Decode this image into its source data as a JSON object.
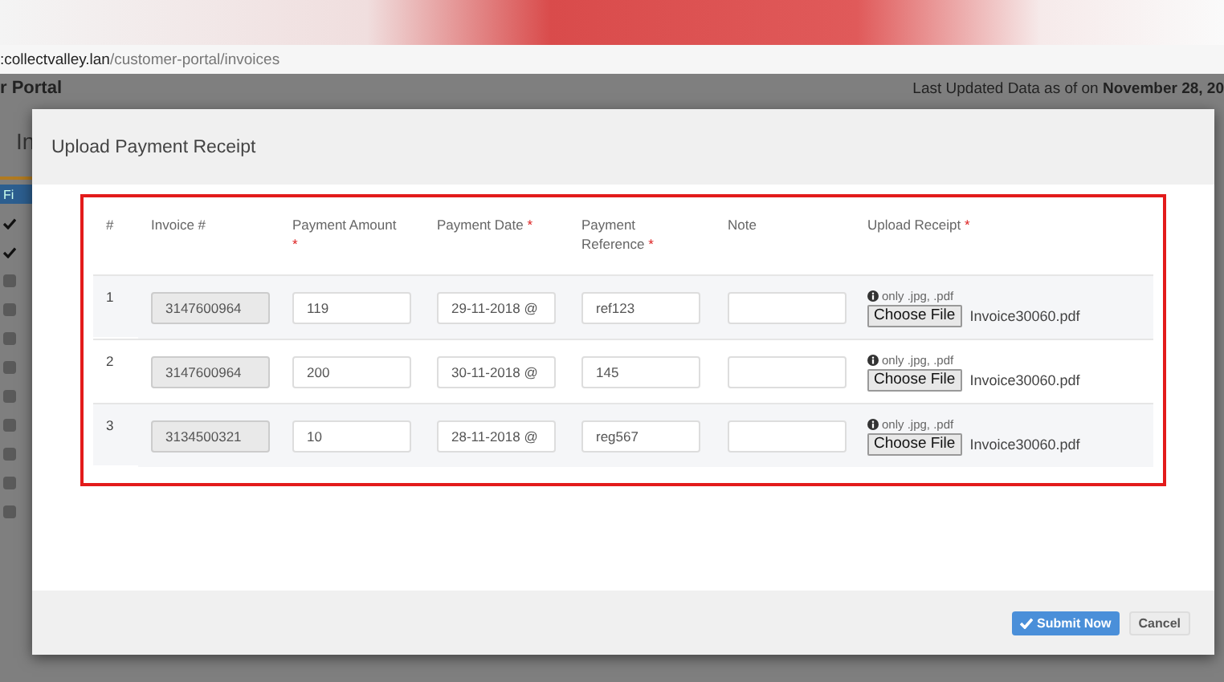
{
  "address_bar": {
    "host": ":collectvalley.lan",
    "path": "/customer-portal/invoices"
  },
  "page": {
    "title": "r Portal",
    "last_updated": "Last Updated Data as of on **November 28, 20**",
    "tab": "In",
    "filter_button": "Fi",
    "row_checks": [
      {
        "checked": true
      },
      {
        "checked": true
      },
      {
        "checked": false
      },
      {
        "checked": false
      },
      {
        "checked": false
      },
      {
        "checked": false
      },
      {
        "checked": false
      },
      {
        "checked": false
      },
      {
        "checked": false
      },
      {
        "checked": false
      },
      {
        "checked": false
      }
    ]
  },
  "modal": {
    "title": "Upload Payment Receipt",
    "columns": [
      {
        "label": "#",
        "required": false
      },
      {
        "label": "Invoice #",
        "required": false
      },
      {
        "label": "Payment Amount",
        "required": true
      },
      {
        "label": "Payment Date",
        "required": true
      },
      {
        "label": "Payment Reference",
        "required": true
      },
      {
        "label": "Note",
        "required": false
      },
      {
        "label": "Upload Receipt",
        "required": true
      }
    ],
    "required_mark": "*",
    "rows": [
      {
        "number": "1",
        "invoice": "3147600964",
        "amount": "119",
        "date": "29-11-2018 @",
        "reference": "ref123",
        "hint": "only .jpg, .pdf",
        "file_button": "Choose File",
        "file_name": "Invoice30060.pdf"
      },
      {
        "number": "2",
        "invoice": "3147600964",
        "amount": "200",
        "date": "30-11-2018 @",
        "reference": "145",
        "hint": "only .jpg, .pdf",
        "file_button": "Choose File",
        "file_name": "Invoice30060.pdf"
      },
      {
        "number": "3",
        "invoice": "3134500321",
        "amount": "10",
        "date": "28-11-2018 @",
        "reference": "reg567",
        "hint": "only .jpg, .pdf",
        "file_button": "Choose File",
        "file_name": "Invoice30060.pdf"
      }
    ],
    "buttons": {
      "submit": "Submit Now",
      "cancel": "Cancel"
    }
  }
}
